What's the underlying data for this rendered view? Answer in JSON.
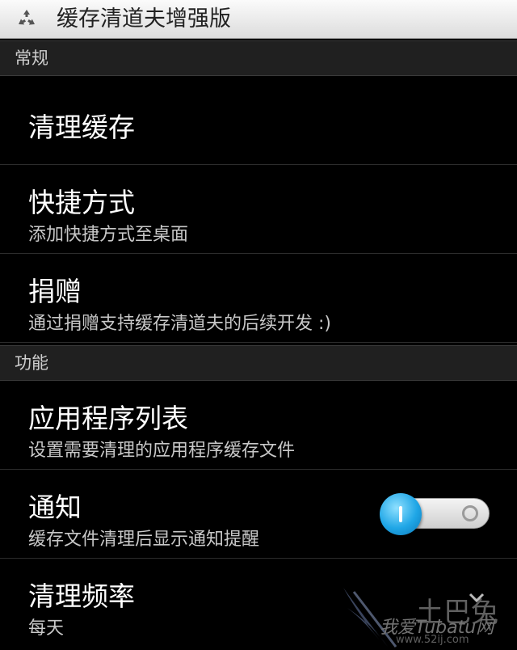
{
  "app": {
    "title": "缓存清道夫增强版",
    "icon": "recycle-icon"
  },
  "categories": [
    {
      "label": "常规",
      "items": [
        {
          "title": "清理缓存",
          "summary": ""
        },
        {
          "title": "快捷方式",
          "summary": "添加快捷方式至桌面"
        },
        {
          "title": "捐赠",
          "summary": "通过捐赠支持缓存清道夫的后续开发 :)"
        }
      ]
    },
    {
      "label": "功能",
      "items": [
        {
          "title": "应用程序列表",
          "summary": "设置需要清理的应用程序缓存文件"
        },
        {
          "title": "通知",
          "summary": "缓存文件清理后显示通知提醒",
          "toggle": "on"
        },
        {
          "title": "清理频率",
          "summary": "每天"
        }
      ]
    }
  ],
  "watermark": {
    "big": "土巴兔",
    "small": "我爱Tubatu网",
    "url": "www.52ij.com"
  },
  "colors": {
    "accent": "#1fa6e6",
    "category_bg": "#202020",
    "titlebar_bg": "#e8e8e8"
  }
}
